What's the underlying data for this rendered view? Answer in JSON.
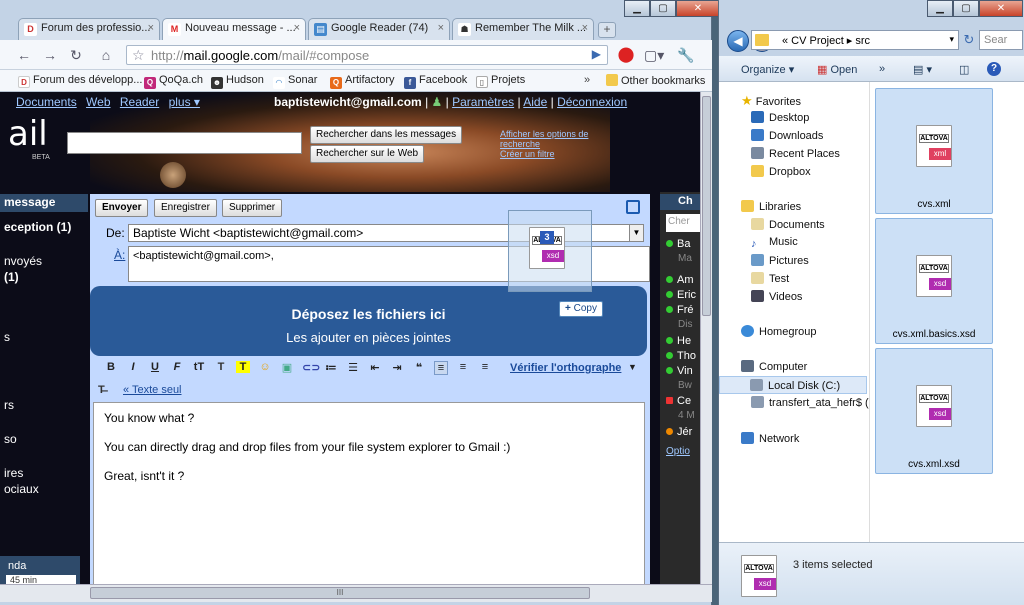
{
  "browser": {
    "tabs": [
      {
        "label": "Forum des professio...",
        "icon": "forum-icon",
        "active": false
      },
      {
        "label": "Nouveau message - ...",
        "icon": "gmail-icon",
        "active": true
      },
      {
        "label": "Google Reader (74)",
        "icon": "reader-icon",
        "active": false
      },
      {
        "label": "Remember The Milk ...",
        "icon": "rtm-icon",
        "active": false
      }
    ],
    "url_prefix": "http://",
    "url_host": "mail.google.com",
    "url_path": "/mail/#compose",
    "bookmarks": [
      "Forum des développ...",
      "QoQa.ch",
      "Hudson",
      "Sonar",
      "Artifactory",
      "Facebook",
      "Projets"
    ],
    "other_bookmarks": "Other bookmarks",
    "scroll_grip": "III"
  },
  "gmail": {
    "topnav": [
      "Documents",
      "Web",
      "Reader",
      "plus ▾"
    ],
    "user_email": "baptistewicht@gmail.com",
    "user_links": [
      "Paramètres",
      "Aide",
      "Déconnexion"
    ],
    "logo": "ail",
    "beta": "BETA",
    "search_mail_btn": "Rechercher dans les messages",
    "search_web_btn": "Rechercher sur le Web",
    "search_options": [
      "Afficher les options de",
      "recherche",
      "Créer un filtre"
    ],
    "leftnav": {
      "compose": "message",
      "inbox": "eception (1)",
      "sent": "nvoyés",
      "count1": "(1)",
      "s": "s",
      "rs": "rs",
      "so": "so",
      "ires": "ires",
      "ociaux": "ociaux",
      "nda": "nda",
      "ms": "45 min"
    },
    "compose": {
      "send_btn": "Envoyer",
      "save_btn": "Enregistrer",
      "delete_btn": "Supprimer",
      "from_label": "De:",
      "from_value": "Baptiste Wicht <baptistewicht@gmail.com>",
      "to_label": "À:",
      "to_value": "<baptistewicht@gmail.com>,",
      "drop_title": "Déposez les fichiers ici",
      "drop_sub": "Les ajouter en pièces jointes",
      "copy_badge": "Copy",
      "drag_count": "3",
      "spell": "Vérifier l'orthographe",
      "plain_text": "« Texte seul",
      "body": [
        "You know what ?",
        "You can directly drag and drop files from your file system explorer to Gmail :)",
        "Great, isnt't it ?"
      ]
    },
    "chat": {
      "header": "Ch",
      "search": "Cher",
      "contacts": [
        {
          "name": "Ba",
          "status": "online",
          "sub": "Ma"
        },
        {
          "name": "Am",
          "status": "online",
          "sub": ""
        },
        {
          "name": "Eric",
          "status": "online",
          "sub": ""
        },
        {
          "name": "Fré",
          "status": "online",
          "sub": "Dis"
        },
        {
          "name": "He",
          "status": "online",
          "sub": ""
        },
        {
          "name": "Tho",
          "status": "online",
          "sub": ""
        },
        {
          "name": "Vin",
          "status": "online",
          "sub": "Bw"
        },
        {
          "name": "Ce",
          "status": "online",
          "sub": "4 M"
        },
        {
          "name": "Jér",
          "status": "away",
          "sub": ""
        }
      ],
      "options": "Optio"
    }
  },
  "explorer": {
    "breadcrumb": "« CV Project ▸ src",
    "search": "Sear",
    "organize": "Organize ▾",
    "open": "Open",
    "more": "»",
    "favorites": "Favorites",
    "fav_items": [
      "Desktop",
      "Downloads",
      "Recent Places",
      "Dropbox"
    ],
    "libraries": "Libraries",
    "lib_items": [
      "Documents",
      "Music",
      "Pictures",
      "Test",
      "Videos"
    ],
    "homegroup": "Homegroup",
    "computer": "Computer",
    "comp_items": [
      "Local Disk (C:)",
      "transfert_ata_hefr$ ("
    ],
    "network": "Network",
    "files": [
      {
        "name": "cvs.xml",
        "ext": "xml"
      },
      {
        "name": "cvs.xml.basics.xsd",
        "ext": "xsd"
      },
      {
        "name": "cvs.xml.xsd",
        "ext": "xsd"
      }
    ],
    "altova": "ALTOVA",
    "status": "3 items selected"
  }
}
